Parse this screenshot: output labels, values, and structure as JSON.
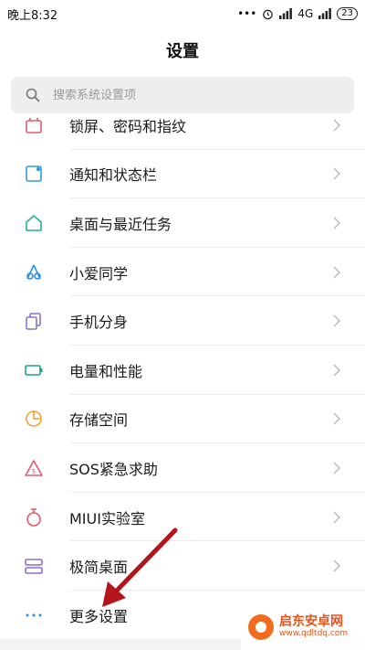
{
  "status_bar": {
    "time": "晚上8:32",
    "network": "4G",
    "battery": "23"
  },
  "header": {
    "title": "设置"
  },
  "search": {
    "placeholder": "搜索系统设置项"
  },
  "items": [
    {
      "label": "锁屏、密码和指纹",
      "icon": "lock-screen-icon",
      "color": "#e45a6c"
    },
    {
      "label": "通知和状态栏",
      "icon": "notification-icon",
      "color": "#2f9be0"
    },
    {
      "label": "桌面与最近任务",
      "icon": "home-icon",
      "color": "#21b28d"
    },
    {
      "label": "小爱同学",
      "icon": "xiaoai-icon",
      "color": "#2a8ee6"
    },
    {
      "label": "手机分身",
      "icon": "clone-icon",
      "color": "#8a6fd6"
    },
    {
      "label": "电量和性能",
      "icon": "battery-icon",
      "color": "#1ba38a"
    },
    {
      "label": "存储空间",
      "icon": "storage-icon",
      "color": "#f0a332"
    },
    {
      "label": "SOS紧急求助",
      "icon": "sos-icon",
      "color": "#e25a6a"
    },
    {
      "label": "MIUI实验室",
      "icon": "lab-icon",
      "color": "#e25a6a"
    },
    {
      "label": "极简桌面",
      "icon": "simple-desktop-icon",
      "color": "#8a6fd6"
    },
    {
      "label": "更多设置",
      "icon": "more-icon",
      "color": "#2a8ee6"
    }
  ],
  "watermark": {
    "title": "启东安卓网",
    "url": "www.qdltdq.com"
  },
  "colors": {
    "accent_arrow": "#b3151b"
  }
}
